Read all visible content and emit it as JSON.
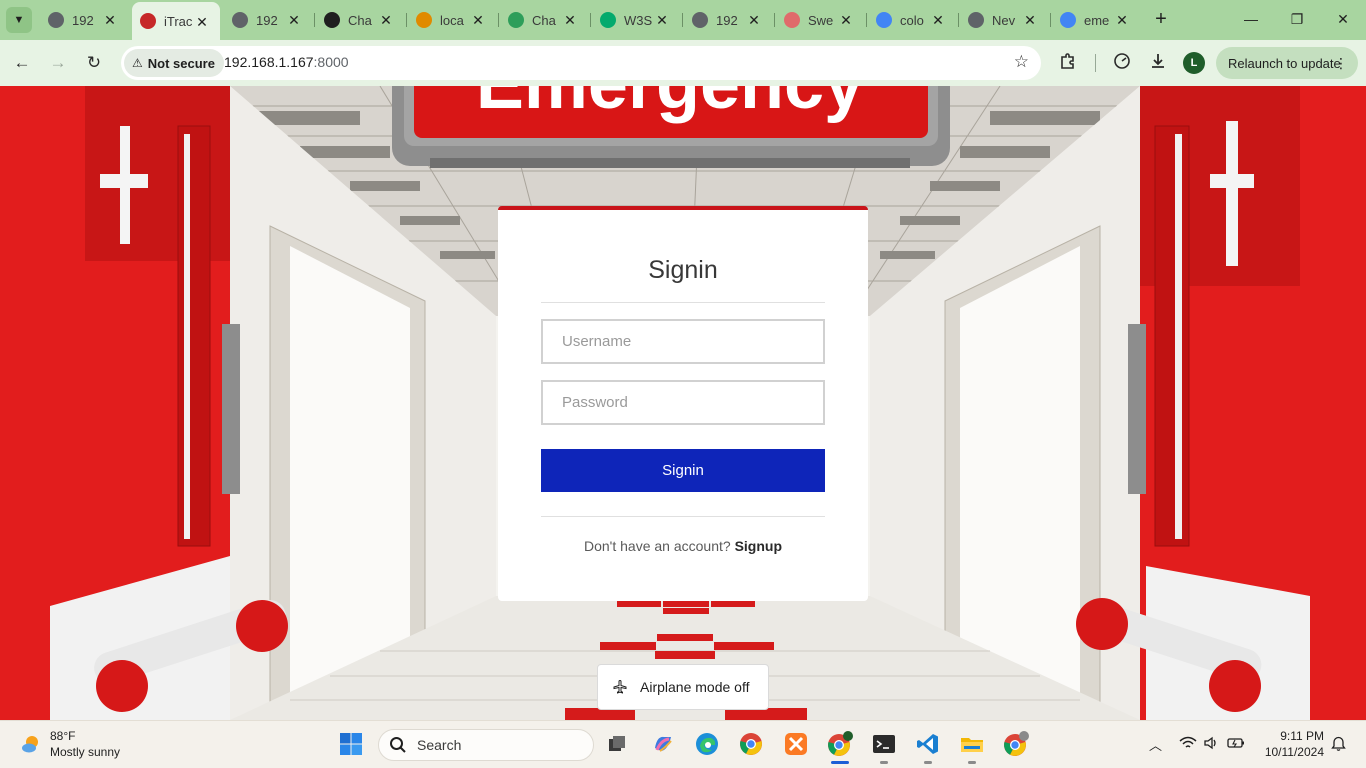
{
  "browser": {
    "tabs": [
      {
        "title": "192",
        "favicon": "globe-icon",
        "color": "#5f6368"
      },
      {
        "title": "iTrac",
        "favicon": "location-pin-icon",
        "color": "#c62828",
        "active": true
      },
      {
        "title": "192",
        "favicon": "globe-icon",
        "color": "#5f6368"
      },
      {
        "title": "Cha",
        "favicon": "chatgpt-icon",
        "color": "#1f1f1f"
      },
      {
        "title": "loca",
        "favicon": "phpmyadmin-icon",
        "color": "#e08a00"
      },
      {
        "title": "Cha",
        "favicon": "w-logo-icon",
        "color": "#2e9e5a"
      },
      {
        "title": "W3S",
        "favicon": "w-logo-icon",
        "color": "#04aa6d"
      },
      {
        "title": "192",
        "favicon": "globe-icon",
        "color": "#5f6368"
      },
      {
        "title": "Swe",
        "favicon": "sweetalert-icon",
        "color": "#e06b6b"
      },
      {
        "title": "colo",
        "favicon": "google-icon",
        "color": "#4285f4"
      },
      {
        "title": "Nev",
        "favicon": "chrome-icon",
        "color": "#5f6368"
      },
      {
        "title": "eme",
        "favicon": "google-icon",
        "color": "#4285f4"
      }
    ],
    "security_label": "Not secure",
    "url_host": "192.168.1.167",
    "url_port": ":8000",
    "profile_initial": "L",
    "relaunch_label": "Relaunch to update"
  },
  "page": {
    "header_text": "Emergency",
    "signin_title": "Signin",
    "username_placeholder": "Username",
    "password_placeholder": "Password",
    "signin_button": "Signin",
    "no_account_text": "Don't have an account?",
    "signup_link": "Signup",
    "accent_color": "#c9141a",
    "button_color": "#0e25b9"
  },
  "toast": {
    "text": "Airplane mode off"
  },
  "taskbar": {
    "temperature": "88°F",
    "weather": "Mostly sunny",
    "search_placeholder": "Search",
    "apps": [
      "windows-start-icon",
      "task-view-icon",
      "copilot-icon",
      "edge-icon",
      "chrome-icon",
      "xampp-icon",
      "chrome-profile-icon",
      "terminal-icon",
      "vscode-icon",
      "file-explorer-icon",
      "chrome-profile-icon"
    ],
    "time": "9:11 PM",
    "date": "10/11/2024"
  }
}
